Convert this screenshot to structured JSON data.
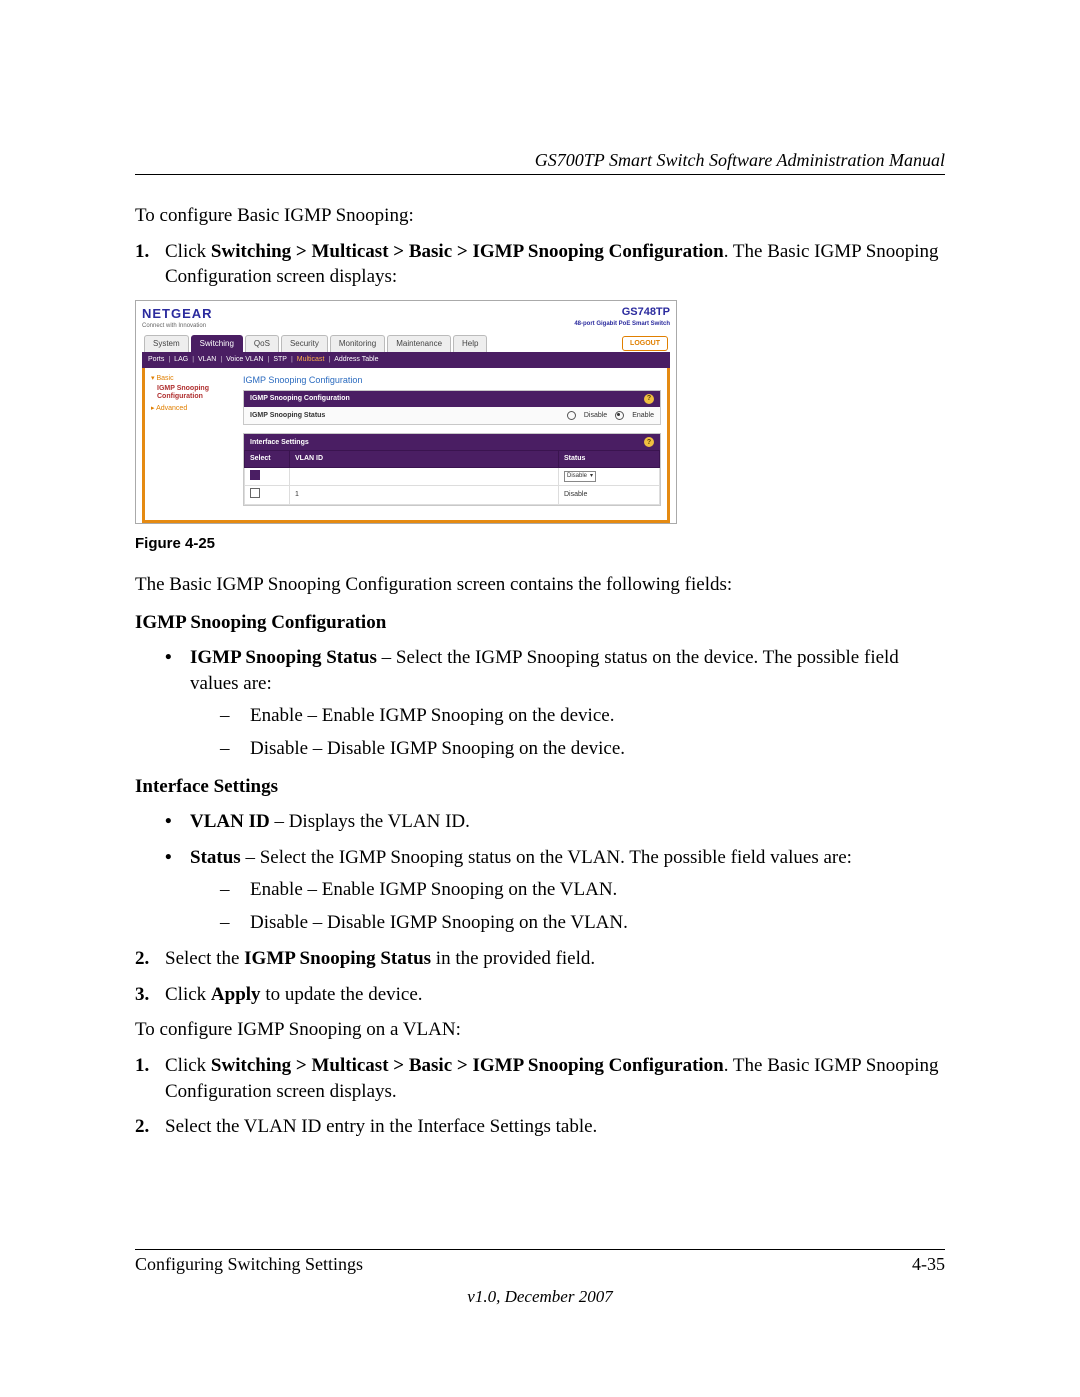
{
  "header": {
    "title": "GS700TP Smart Switch Software Administration Manual"
  },
  "intro": "To configure Basic IGMP Snooping:",
  "step1": {
    "num": "1.",
    "pre": "Click ",
    "path": "Switching > Multicast > Basic > IGMP Snooping Configuration",
    "post": ". The Basic IGMP Snooping Configuration screen displays:"
  },
  "figure_caption": "Figure 4-25",
  "after_figure": "The Basic IGMP Snooping Configuration screen contains the following fields:",
  "sec1": {
    "heading": "IGMP Snooping Configuration",
    "item1_term": "IGMP Snooping Status",
    "item1_rest": " – Select the IGMP Snooping status on the device. The possible field values are:",
    "d1": "Enable – Enable IGMP Snooping on the device.",
    "d2": "Disable – Disable IGMP Snooping on the device."
  },
  "sec2": {
    "heading": "Interface Settings",
    "item1_term": "VLAN ID",
    "item1_rest": " – Displays the VLAN ID.",
    "item2_term": "Status",
    "item2_rest": " – Select the IGMP Snooping status on the VLAN. The possible field values are:",
    "d1": "Enable – Enable IGMP Snooping on the VLAN.",
    "d2": "Disable – Disable IGMP Snooping on the VLAN."
  },
  "step2": {
    "num": "2.",
    "pre": "Select the ",
    "bold": "IGMP Snooping Status",
    "post": " in the provided field."
  },
  "step3": {
    "num": "3.",
    "pre": "Click ",
    "bold": "Apply",
    "post": " to update the device."
  },
  "vlan_intro": "To configure IGMP Snooping on a VLAN:",
  "vstep1": {
    "num": "1.",
    "pre": "Click ",
    "path": "Switching > Multicast > Basic > IGMP Snooping Configuration",
    "post": ". The Basic IGMP Snooping Configuration screen displays."
  },
  "vstep2": {
    "num": "2.",
    "text": "Select the VLAN ID entry in the Interface Settings table."
  },
  "footer": {
    "left": "Configuring Switching Settings",
    "right": "4-35",
    "version": "v1.0, December 2007"
  },
  "shot": {
    "brand": "NETGEAR",
    "tagline": "Connect with Innovation",
    "model": "GS748TP",
    "model_desc": "48-port Gigabit PoE Smart Switch",
    "tabs": [
      "System",
      "Switching",
      "QoS",
      "Security",
      "Monitoring",
      "Maintenance",
      "Help"
    ],
    "logout": "LOGOUT",
    "subnav": [
      "Ports",
      "LAG",
      "VLAN",
      "Voice VLAN",
      "STP",
      "Multicast",
      "Address Table"
    ],
    "sidenav": {
      "basic": "Basic",
      "item": "IGMP Snooping Configuration",
      "advanced": "Advanced"
    },
    "content_title": "IGMP Snooping Configuration",
    "panel1_title": "IGMP Snooping Configuration",
    "status_label": "IGMP Snooping Status",
    "opt_disable": "Disable",
    "opt_enable": "Enable",
    "panel2_title": "Interface Settings",
    "th_select": "Select",
    "th_vlan": "VLAN ID",
    "th_status": "Status",
    "row_dropdown": "Disable",
    "row_vlan": "1",
    "row_status": "Disable",
    "help": "?"
  }
}
